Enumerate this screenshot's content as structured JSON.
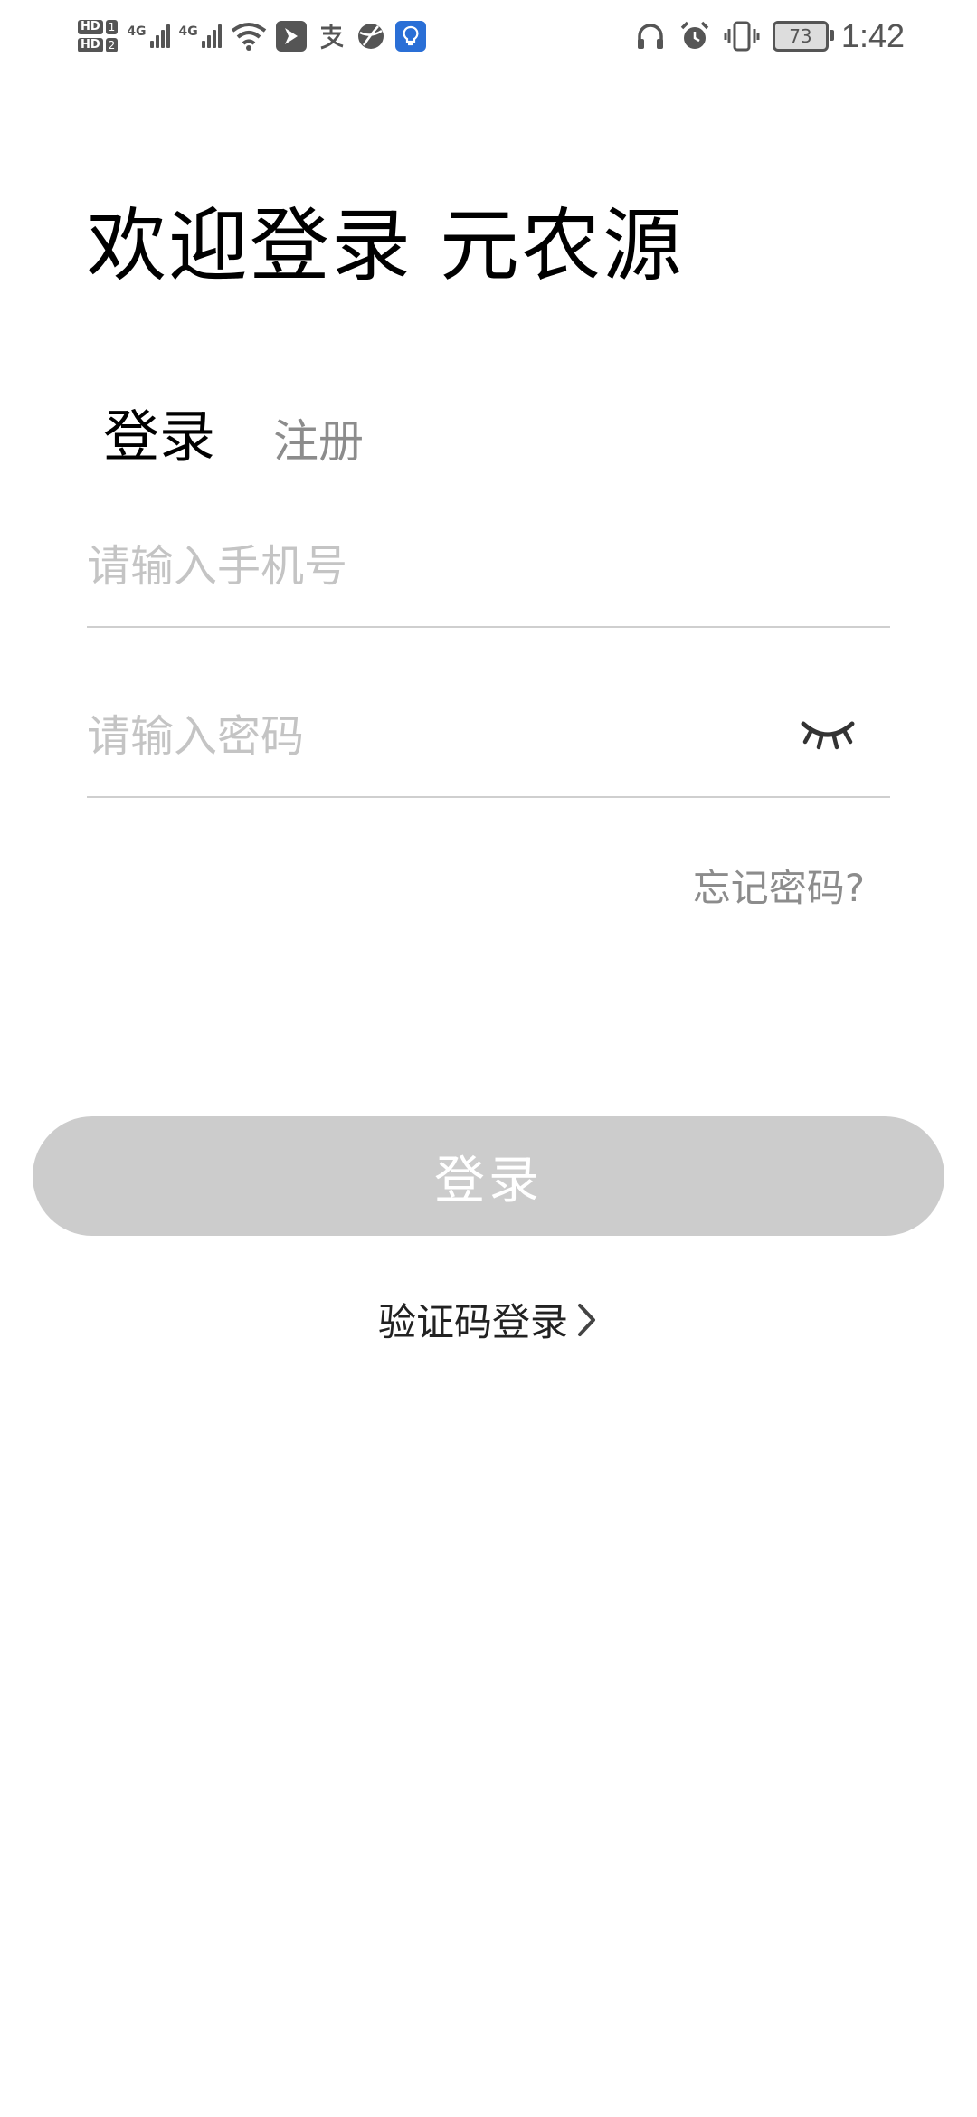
{
  "status_bar": {
    "hd1": "HD",
    "hd1_num": "1",
    "hd2": "HD",
    "hd2_num": "2",
    "network1": "4G",
    "network2": "4G",
    "battery_level": "73",
    "time": "1:42",
    "icons": [
      "wifi-icon",
      "app-arrow-icon",
      "alipay-icon",
      "globe-icon",
      "lightbulb-icon",
      "headphones-icon",
      "alarm-icon",
      "vibrate-icon",
      "battery-icon"
    ]
  },
  "page": {
    "title": "欢迎登录 元农源"
  },
  "tabs": {
    "login": "登录",
    "register": "注册",
    "active": "login",
    "accent_color": "#f1b694"
  },
  "form": {
    "phone_placeholder": "请输入手机号",
    "password_placeholder": "请输入密码",
    "forgot_password": "忘记密码?",
    "submit_label": "登录",
    "sms_login": "验证码登录"
  }
}
